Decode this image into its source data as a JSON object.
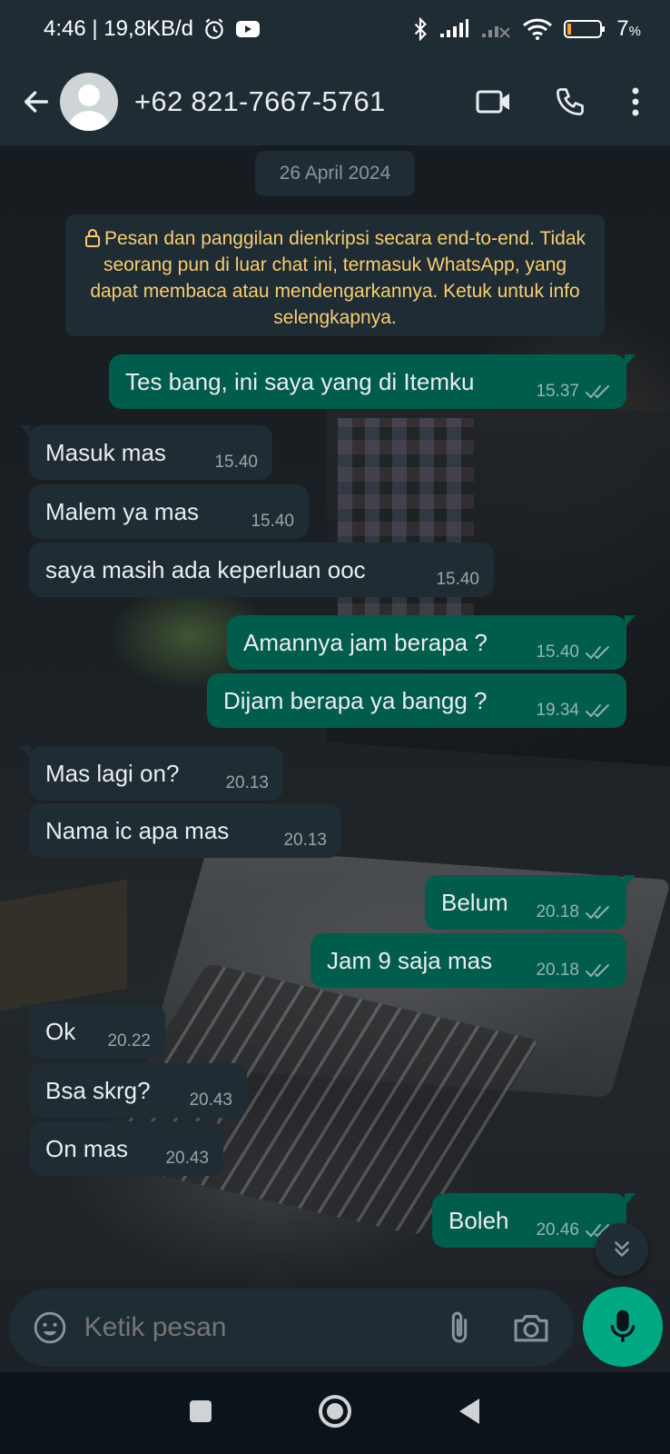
{
  "status_bar": {
    "time_speed": "4:46 | 19,8KB/d",
    "battery": "7",
    "battery_unit": "%",
    "icons": [
      "alarm-icon",
      "youtube-icon",
      "bluetooth-icon",
      "signal-icon",
      "signal-no-service-icon",
      "wifi-icon",
      "battery-icon"
    ]
  },
  "header": {
    "contact_name": "+62 821-7667-5761",
    "icons": [
      "back-arrow-icon",
      "avatar-icon",
      "video-call-icon",
      "voice-call-icon",
      "more-options-icon"
    ]
  },
  "chat": {
    "date_chip": "26 April 2024",
    "encryption_notice": "Pesan dan panggilan dienkripsi secara end-to-end. Tidak seorang pun di luar chat ini, termasuk WhatsApp, yang dapat membaca atau mendengarkannya. Ketuk untuk info selengkapnya.",
    "messages": [
      {
        "text": "Tes bang, ini saya yang di Itemku",
        "time": "15.37",
        "direction": "out",
        "status": "read"
      },
      {
        "text": "Masuk mas",
        "time": "15.40",
        "direction": "in"
      },
      {
        "text": "Malem ya mas",
        "time": "15.40",
        "direction": "in"
      },
      {
        "text": "saya masih ada keperluan ooc",
        "time": "15.40",
        "direction": "in"
      },
      {
        "text": "Amannya jam berapa ?",
        "time": "15.40",
        "direction": "out",
        "status": "read"
      },
      {
        "text": "Dijam berapa ya bangg ?",
        "time": "19.34",
        "direction": "out",
        "status": "read"
      },
      {
        "text": "Mas lagi on?",
        "time": "20.13",
        "direction": "in"
      },
      {
        "text": "Nama ic apa mas",
        "time": "20.13",
        "direction": "in"
      },
      {
        "text": "Belum",
        "time": "20.18",
        "direction": "out",
        "status": "read"
      },
      {
        "text": "Jam 9 saja mas",
        "time": "20.18",
        "direction": "out",
        "status": "read"
      },
      {
        "text": "Ok",
        "time": "20.22",
        "direction": "in"
      },
      {
        "text": "Bsa skrg?",
        "time": "20.43",
        "direction": "in"
      },
      {
        "text": "On mas",
        "time": "20.43",
        "direction": "in"
      },
      {
        "text": "Boleh",
        "time": "20.46",
        "direction": "out",
        "status": "read"
      }
    ]
  },
  "input_bar": {
    "placeholder": "Ketik pesan",
    "icons": [
      "emoji-icon",
      "attach-icon",
      "camera-icon",
      "microphone-icon"
    ]
  },
  "nav_bar": {
    "icons": [
      "recent-apps-icon",
      "home-icon",
      "back-icon"
    ]
  },
  "colors": {
    "header_bg": "#1f2c34",
    "incoming_bubble": "#1f2c34",
    "outgoing_bubble": "#005c4b",
    "accent_green": "#00a884",
    "notice_text": "#f7cd73",
    "secondary_text": "#8696a0"
  }
}
